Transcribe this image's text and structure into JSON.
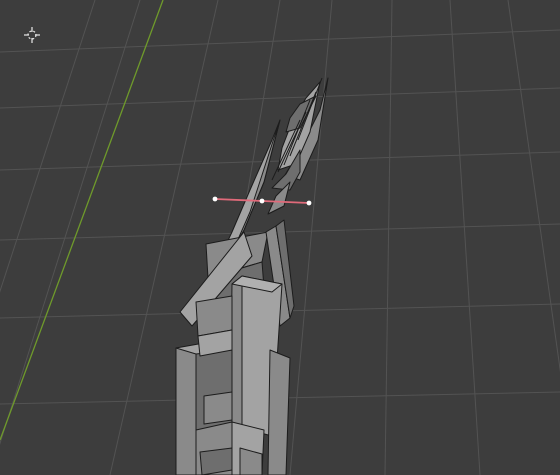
{
  "viewport": {
    "background_color": "#3d3d3d",
    "grid_line_color": "#535353",
    "grid_axis_y_color": "#6f9a2b",
    "mesh_face_color": "#8a8a8a",
    "mesh_face_dark_color": "#6e6e6e",
    "mesh_face_light_color": "#a3a3a3",
    "mesh_edge_color": "#1c1c1c",
    "active_edge_color": "#e06a7a",
    "active_vertex_color": "#ffffff",
    "cursor_icon": "3d-cursor-crosshair-icon"
  }
}
